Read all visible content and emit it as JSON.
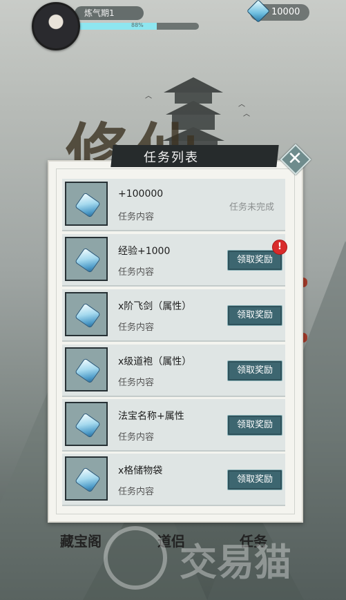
{
  "hud": {
    "level_label": "炼气期1",
    "xp_text": "88%",
    "xp_fraction": 0.66,
    "gem_count": "10000"
  },
  "background": {
    "title_art": "修仙"
  },
  "modal": {
    "title": "任务列表",
    "close_symbol": "✕",
    "tasks": [
      {
        "title": "+100000",
        "subtitle": "任务内容",
        "status": "任务未完成",
        "button": ""
      },
      {
        "title": "经验+1000",
        "subtitle": "任务内容",
        "status": "",
        "button": "领取奖励"
      },
      {
        "title": "x阶飞剑（属性）",
        "subtitle": "任务内容",
        "status": "",
        "button": "领取奖励"
      },
      {
        "title": "x级道袍（属性）",
        "subtitle": "任务内容",
        "status": "",
        "button": "领取奖励"
      },
      {
        "title": "法宝名称+属性",
        "subtitle": "任务内容",
        "status": "",
        "button": "领取奖励"
      },
      {
        "title": "x格储物袋",
        "subtitle": "任务内容",
        "status": "",
        "button": "领取奖励"
      }
    ],
    "notify_badge": "!"
  },
  "bottom_nav": {
    "items": [
      "藏宝阁",
      "道侣",
      "任务"
    ]
  },
  "watermark": {
    "text": "交易猫"
  },
  "colors": {
    "accent": "#3d6670",
    "badge_red": "#d92b2b",
    "title_bar": "#262b2c"
  }
}
